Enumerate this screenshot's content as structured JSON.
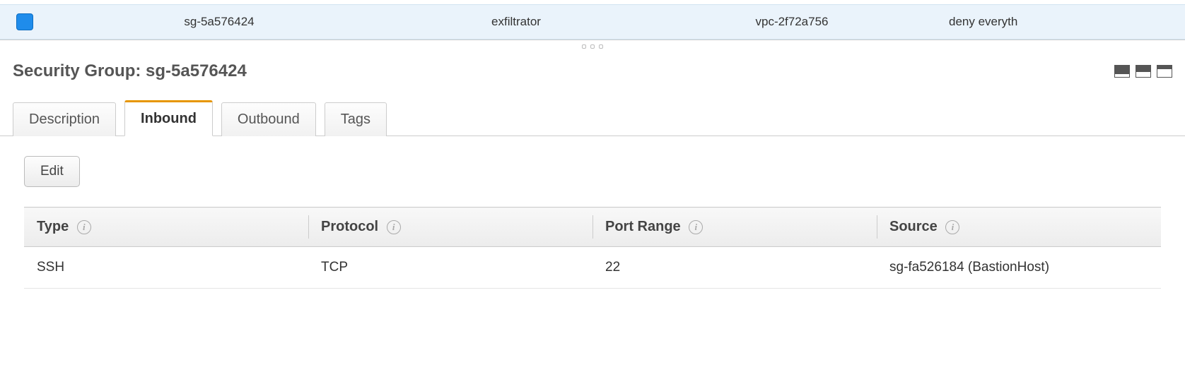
{
  "list": {
    "selected_row": {
      "group_id": "sg-5a576424",
      "group_name": "exfiltrator",
      "vpc_id": "vpc-2f72a756",
      "description": "deny everyth"
    }
  },
  "detail": {
    "title_prefix": "Security Group: ",
    "title_id": "sg-5a576424"
  },
  "tabs": {
    "description": "Description",
    "inbound": "Inbound",
    "outbound": "Outbound",
    "tags": "Tags"
  },
  "inbound": {
    "edit_label": "Edit",
    "columns": {
      "type": "Type",
      "protocol": "Protocol",
      "port_range": "Port Range",
      "source": "Source"
    },
    "rules": [
      {
        "type": "SSH",
        "protocol": "TCP",
        "port_range": "22",
        "source": "sg-fa526184 (BastionHost)"
      }
    ]
  }
}
